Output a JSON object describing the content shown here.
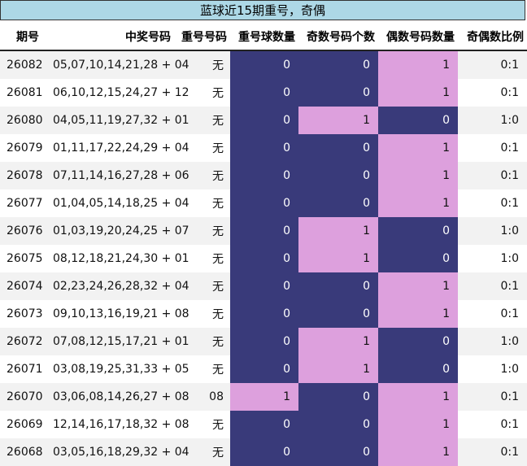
{
  "title": "蓝球近15期重号，奇偶",
  "colors": {
    "header_bg": "#add8e6",
    "dark": "#393a7a",
    "pink": "#dda0dd",
    "stripe": "#f2f2f2"
  },
  "columns": [
    "期号",
    "中奖号码",
    "重号号码",
    "重号球数量",
    "奇数号码个数",
    "偶数号码数量",
    "奇偶数比例"
  ],
  "rows": [
    {
      "issue": "26082",
      "draw": "05,07,10,14,21,28 + 04",
      "repeat": "无",
      "repeat_count": "0",
      "odd": "0",
      "even": "1",
      "ratio": "0:1"
    },
    {
      "issue": "26081",
      "draw": "06,10,12,15,24,27 + 12",
      "repeat": "无",
      "repeat_count": "0",
      "odd": "0",
      "even": "1",
      "ratio": "0:1"
    },
    {
      "issue": "26080",
      "draw": "04,05,11,19,27,32 + 01",
      "repeat": "无",
      "repeat_count": "0",
      "odd": "1",
      "even": "0",
      "ratio": "1:0"
    },
    {
      "issue": "26079",
      "draw": "01,11,17,22,24,29 + 04",
      "repeat": "无",
      "repeat_count": "0",
      "odd": "0",
      "even": "1",
      "ratio": "0:1"
    },
    {
      "issue": "26078",
      "draw": "07,11,14,16,27,28 + 06",
      "repeat": "无",
      "repeat_count": "0",
      "odd": "0",
      "even": "1",
      "ratio": "0:1"
    },
    {
      "issue": "26077",
      "draw": "01,04,05,14,18,25 + 04",
      "repeat": "无",
      "repeat_count": "0",
      "odd": "0",
      "even": "1",
      "ratio": "0:1"
    },
    {
      "issue": "26076",
      "draw": "01,03,19,20,24,25 + 07",
      "repeat": "无",
      "repeat_count": "0",
      "odd": "1",
      "even": "0",
      "ratio": "1:0"
    },
    {
      "issue": "26075",
      "draw": "08,12,18,21,24,30 + 01",
      "repeat": "无",
      "repeat_count": "0",
      "odd": "1",
      "even": "0",
      "ratio": "1:0"
    },
    {
      "issue": "26074",
      "draw": "02,23,24,26,28,32 + 04",
      "repeat": "无",
      "repeat_count": "0",
      "odd": "0",
      "even": "1",
      "ratio": "0:1"
    },
    {
      "issue": "26073",
      "draw": "09,10,13,16,19,21 + 08",
      "repeat": "无",
      "repeat_count": "0",
      "odd": "0",
      "even": "1",
      "ratio": "0:1"
    },
    {
      "issue": "26072",
      "draw": "07,08,12,15,17,21 + 01",
      "repeat": "无",
      "repeat_count": "0",
      "odd": "1",
      "even": "0",
      "ratio": "1:0"
    },
    {
      "issue": "26071",
      "draw": "03,08,19,25,31,33 + 05",
      "repeat": "无",
      "repeat_count": "0",
      "odd": "1",
      "even": "0",
      "ratio": "1:0"
    },
    {
      "issue": "26070",
      "draw": "03,06,08,14,26,27 + 08",
      "repeat": "08",
      "repeat_count": "1",
      "odd": "0",
      "even": "1",
      "ratio": "0:1"
    },
    {
      "issue": "26069",
      "draw": "12,14,16,17,18,32 + 08",
      "repeat": "无",
      "repeat_count": "0",
      "odd": "0",
      "even": "1",
      "ratio": "0:1"
    },
    {
      "issue": "26068",
      "draw": "03,05,16,18,29,32 + 04",
      "repeat": "无",
      "repeat_count": "0",
      "odd": "0",
      "even": "1",
      "ratio": "0:1"
    }
  ]
}
